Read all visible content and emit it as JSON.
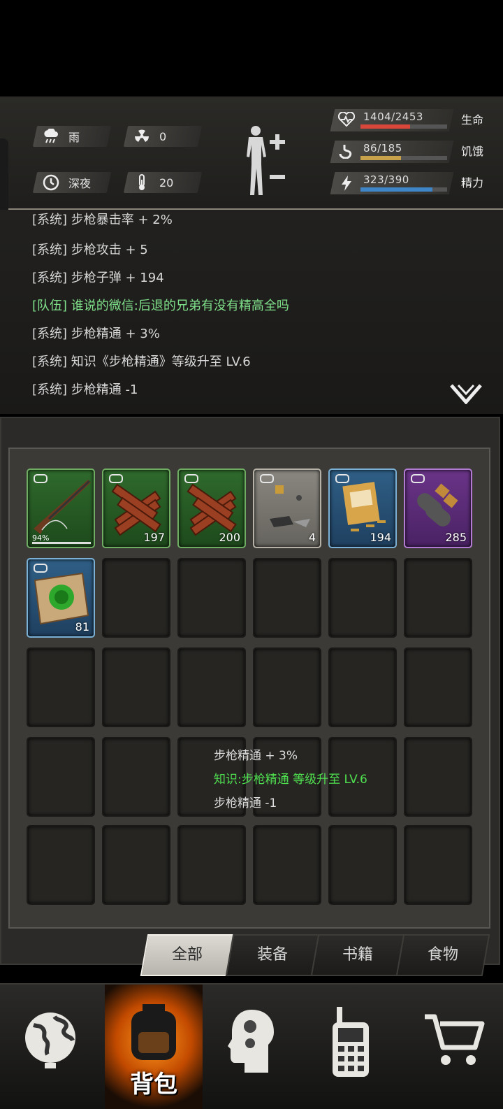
{
  "status": {
    "weather": {
      "icon": "rain-cloud-icon",
      "label": "雨"
    },
    "radiation": {
      "icon": "radiation-icon",
      "value": "0"
    },
    "time": {
      "icon": "clock-icon",
      "label": "深夜"
    },
    "temperature": {
      "icon": "thermometer-icon",
      "value": "20"
    },
    "stats": [
      {
        "name": "health",
        "icon": "heartbeat-icon",
        "value": "1404/2453",
        "label": "生命",
        "fraction": 0.572,
        "color": "#d9463a"
      },
      {
        "name": "hunger",
        "icon": "stomach-icon",
        "value": "86/185",
        "label": "饥饿",
        "fraction": 0.465,
        "color": "#c8a24a"
      },
      {
        "name": "energy",
        "icon": "energy-icon",
        "value": "323/390",
        "label": "精力",
        "fraction": 0.828,
        "color": "#3f86c8"
      }
    ]
  },
  "log": [
    {
      "tag": "[系统]",
      "text": "步枪暴击率 + 2%",
      "type": "system"
    },
    {
      "tag": "[系统]",
      "text": "步枪攻击 + 5",
      "type": "system"
    },
    {
      "tag": "[系统]",
      "text": "步枪子弹 + 194",
      "type": "system"
    },
    {
      "tag": "[队伍]",
      "text": "谁说的微信:后退的兄弟有没有精高全吗",
      "type": "team"
    },
    {
      "tag": "[系统]",
      "text": "步枪精通 + 3%",
      "type": "system"
    },
    {
      "tag": "[系统]",
      "text": "知识《步枪精通》等级升至 LV.6",
      "type": "system"
    },
    {
      "tag": "[系统]",
      "text": "步枪精通 -1",
      "type": "system"
    }
  ],
  "inventory": {
    "items": [
      {
        "name": "rifle",
        "rarity": "green",
        "durability": "94%",
        "qty": ""
      },
      {
        "name": "wood-planks",
        "rarity": "green",
        "qty": "197"
      },
      {
        "name": "wood-planks",
        "rarity": "green",
        "qty": "200"
      },
      {
        "name": "scrap-parts",
        "rarity": "gray",
        "qty": "4"
      },
      {
        "name": "rifle-ammo-box",
        "rarity": "blue",
        "qty": "194"
      },
      {
        "name": "shells",
        "rarity": "purple",
        "qty": "285"
      },
      {
        "name": "herb-paper",
        "rarity": "blue",
        "qty": "81"
      }
    ]
  },
  "popup": {
    "line1": "步枪精通 + 3%",
    "line2": "知识:步枪精通 等级升至 LV.6",
    "line3": "步枪精通 -1"
  },
  "tabs": [
    "全部",
    "装备",
    "书籍",
    "食物"
  ],
  "nav": {
    "items": [
      {
        "name": "world-map",
        "icon": "globe-icon",
        "label": ""
      },
      {
        "name": "backpack",
        "icon": "backpack-icon",
        "label": "背包"
      },
      {
        "name": "skills",
        "icon": "brain-icon",
        "label": ""
      },
      {
        "name": "radio",
        "icon": "walkie-talkie-icon",
        "label": ""
      },
      {
        "name": "shop",
        "icon": "cart-icon",
        "label": ""
      }
    ]
  }
}
